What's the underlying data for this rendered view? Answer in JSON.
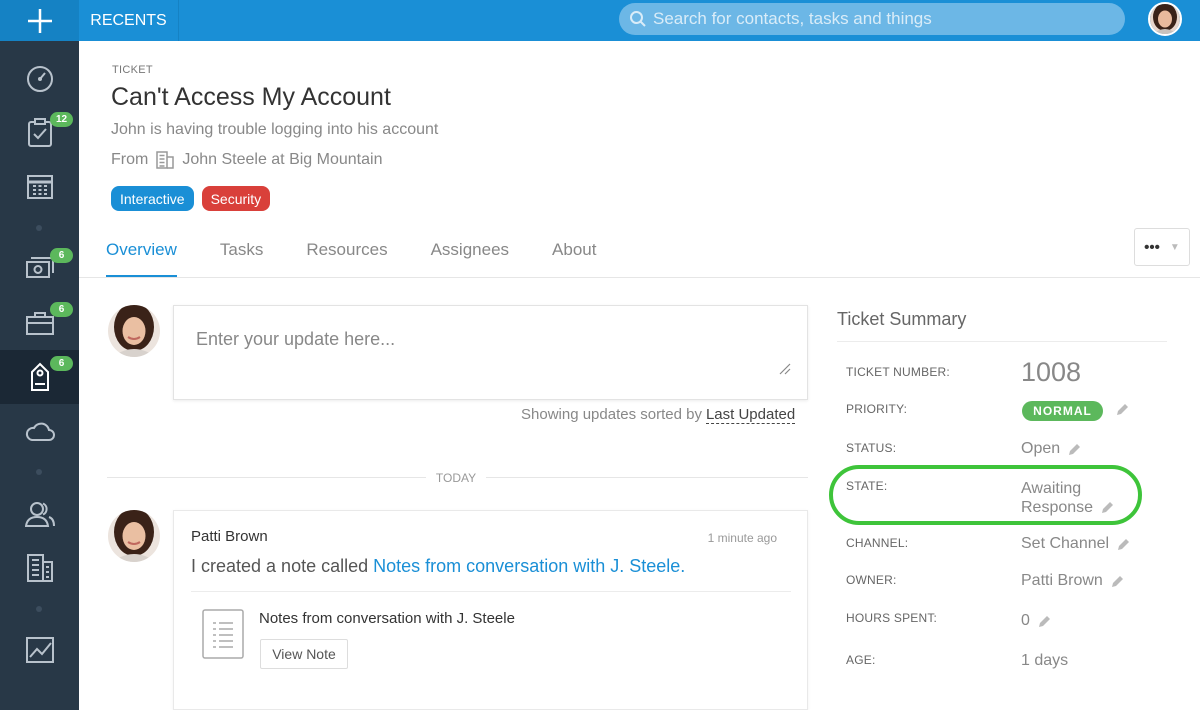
{
  "topbar": {
    "add_icon": "plus-icon",
    "recents_label": "RECENTS",
    "search_placeholder": "Search for contacts, tasks and things"
  },
  "sidebar": {
    "items": [
      {
        "name": "dashboard",
        "icon": "gauge-icon",
        "badge": ""
      },
      {
        "name": "tasks",
        "icon": "clipboard-check-icon",
        "badge": "12"
      },
      {
        "name": "calendar",
        "icon": "calendar-icon",
        "badge": ""
      },
      {
        "name": "money",
        "icon": "money-icon",
        "badge": "6"
      },
      {
        "name": "projects",
        "icon": "briefcase-icon",
        "badge": "6"
      },
      {
        "name": "tickets",
        "icon": "tag-icon",
        "badge": "6"
      },
      {
        "name": "cloud",
        "icon": "cloud-icon",
        "badge": ""
      },
      {
        "name": "contacts",
        "icon": "people-icon",
        "badge": ""
      },
      {
        "name": "companies",
        "icon": "building-icon",
        "badge": ""
      },
      {
        "name": "reports",
        "icon": "chart-icon",
        "badge": ""
      }
    ]
  },
  "ticket": {
    "eyebrow": "TICKET",
    "title": "Can't Access My Account",
    "description": "John is having trouble logging into his account",
    "from_label": "From",
    "from_value": "John Steele at Big Mountain",
    "tags": [
      "Interactive",
      "Security"
    ]
  },
  "tabs": [
    "Overview",
    "Tasks",
    "Resources",
    "Assignees",
    "About"
  ],
  "more_button": "•••",
  "update": {
    "placeholder": "Enter your update here...",
    "sorted_label": "Showing updates sorted by",
    "sorted_value": "Last Updated"
  },
  "feed": {
    "day_label": "TODAY",
    "item": {
      "author": "Patti Brown",
      "time": "1 minute ago",
      "text_prefix": "I created a note called",
      "text_link": "Notes from conversation with J. Steele.",
      "note_title": "Notes from conversation with J. Steele",
      "view_button": "View Note"
    }
  },
  "summary": {
    "title": "Ticket Summary",
    "ticket_number_label": "TICKET NUMBER:",
    "ticket_number": "1008",
    "priority_label": "PRIORITY:",
    "priority": "NORMAL",
    "status_label": "STATUS:",
    "status": "Open",
    "state_label": "STATE:",
    "state_line1": "Awaiting",
    "state_line2": "Response",
    "channel_label": "CHANNEL:",
    "channel": "Set Channel",
    "owner_label": "OWNER:",
    "owner": "Patti Brown",
    "hours_label": "HOURS SPENT:",
    "hours": "0",
    "age_label": "AGE:",
    "age": "1 days"
  },
  "colors": {
    "accent": "#1a8fd6",
    "sidebar": "#283847",
    "badge_green": "#5cb85c",
    "tag_red": "#d9403a",
    "highlight_green": "#3ec43a"
  }
}
